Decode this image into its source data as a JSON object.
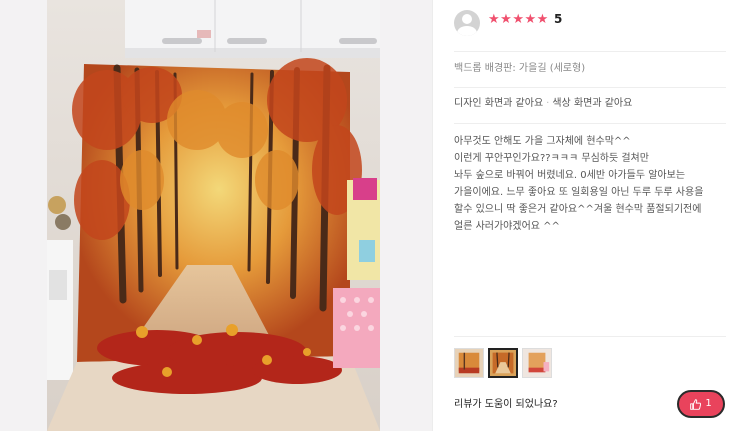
{
  "review": {
    "rating": {
      "value": 5,
      "max": 5,
      "label": "5",
      "star_color": "#f0506e"
    },
    "product_option": "백드롭 배경판: 가을길 (세로형)",
    "evaluations": [
      "디자인 화면과 같아요",
      "색상 화면과 같아요"
    ],
    "body_lines": [
      "아무것도 안해도 가을 그자체에 현수막^^",
      "이런게 꾸안꾸인가요??ㅋㅋㅋ 무심하듯 걸쳐만",
      "놔두 숲으로 바꿔어 버렸네요. 0세반 아가들두 알아보는",
      "가을이에요. 느무 좋아요 또 일회용일 아닌 두루 두루 사용을",
      "할수 있으니 딱 좋은거 같아요^^겨울 현수막 품절되기전에",
      "얼른 사러가야겠어요 ^^"
    ],
    "thumbnails": [
      {
        "name": "thumb-1",
        "selected": false
      },
      {
        "name": "thumb-2",
        "selected": true
      },
      {
        "name": "thumb-3",
        "selected": false
      }
    ],
    "helpful_question": "리뷰가 도움이 되었나요?",
    "helpful_count": "1",
    "accent_color": "#e9435c"
  }
}
